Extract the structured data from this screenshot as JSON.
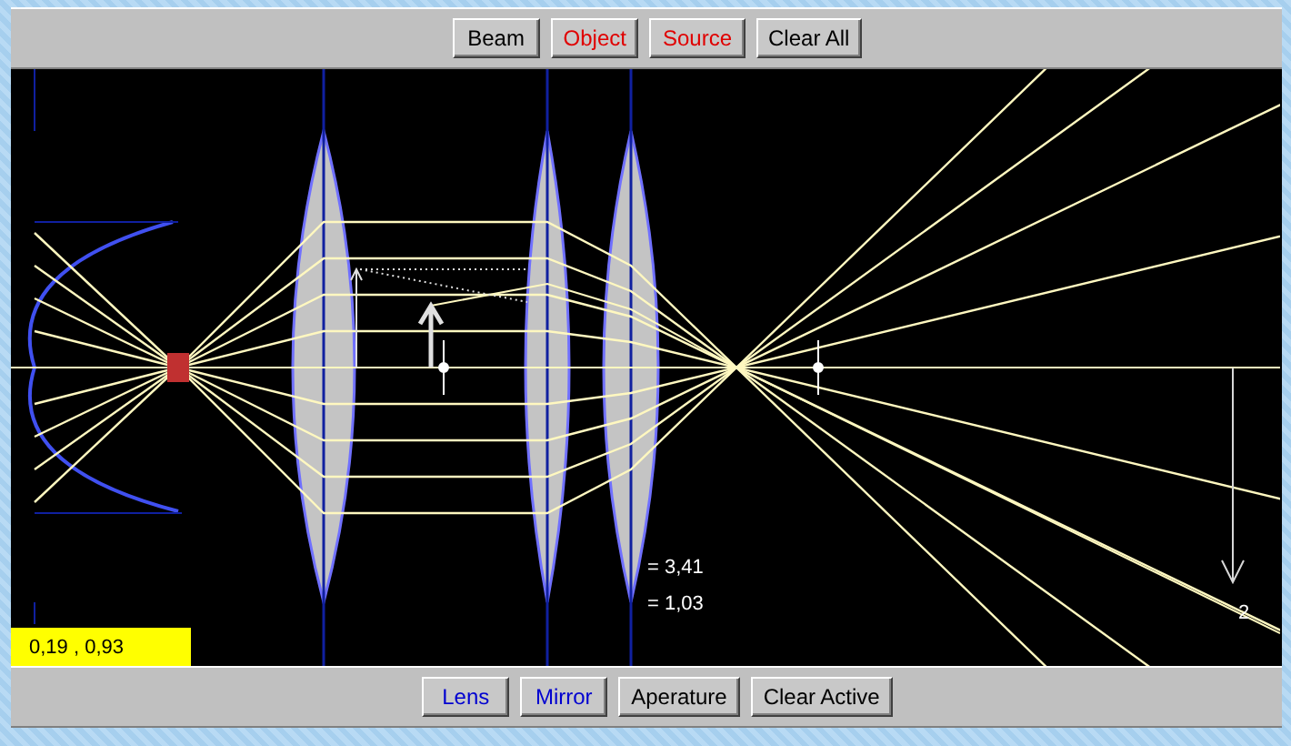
{
  "top_toolbar": {
    "buttons": [
      {
        "label": "Beam",
        "active": false
      },
      {
        "label": "Object",
        "active": true
      },
      {
        "label": "Source",
        "active": true
      },
      {
        "label": "Clear All",
        "active": false
      }
    ]
  },
  "canvas": {
    "readouts": [
      {
        "text": "= 3,41"
      },
      {
        "text": "= 1,03"
      }
    ],
    "image_label": "2",
    "coordinates": "0,19 , 0,93"
  },
  "bottom_toolbar": {
    "buttons": [
      {
        "label": "Lens",
        "active": true
      },
      {
        "label": "Mirror",
        "active": true
      },
      {
        "label": "Aperature",
        "active": false
      },
      {
        "label": "Clear Active",
        "active": false
      }
    ]
  }
}
